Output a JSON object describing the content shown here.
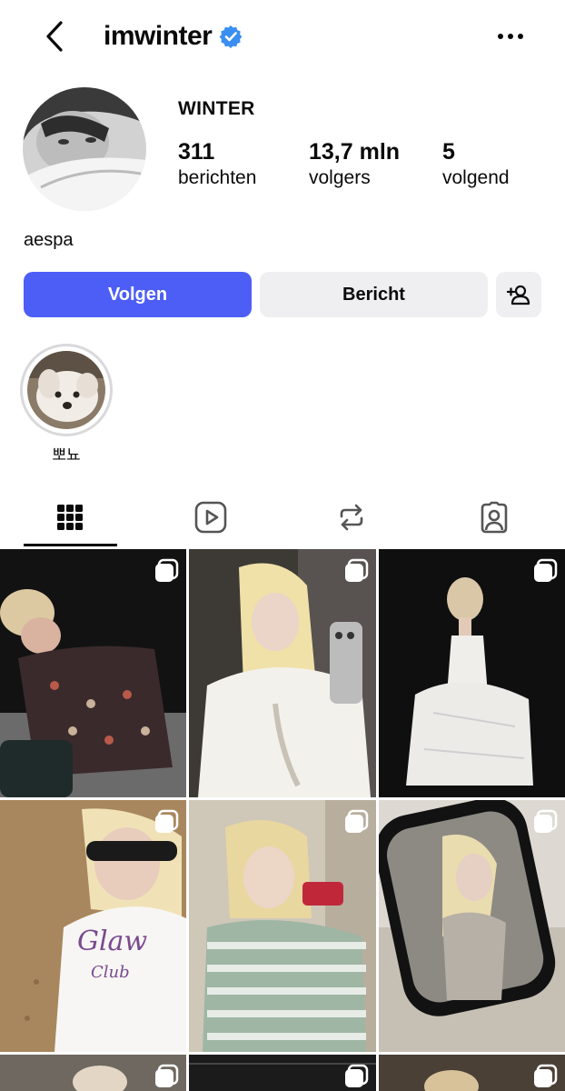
{
  "header": {
    "username": "imwinter",
    "back_icon": "chevron-left-icon",
    "verified_icon": "verified-badge-icon",
    "more_icon": "more-horizontal-icon"
  },
  "profile": {
    "display_name": "WINTER",
    "bio": "aespa",
    "stats": {
      "posts": {
        "value": "311",
        "label": "berichten"
      },
      "followers": {
        "value": "13,7 mln",
        "label": "volgers"
      },
      "following": {
        "value": "5",
        "label": "volgend"
      }
    }
  },
  "actions": {
    "follow_label": "Volgen",
    "message_label": "Bericht",
    "add_user_icon": "add-user-icon"
  },
  "highlights": [
    {
      "label": "뽀뇨"
    }
  ],
  "tabs": [
    {
      "name": "posts-grid",
      "icon": "grid-icon",
      "active": true
    },
    {
      "name": "reels",
      "icon": "reels-icon",
      "active": false
    },
    {
      "name": "reposts",
      "icon": "repost-icon",
      "active": false
    },
    {
      "name": "tagged",
      "icon": "tagged-person-icon",
      "active": false
    }
  ],
  "colors": {
    "accent": "#4d5ef7",
    "verified": "#3b8ef2",
    "secondary_button": "#efeff2"
  }
}
